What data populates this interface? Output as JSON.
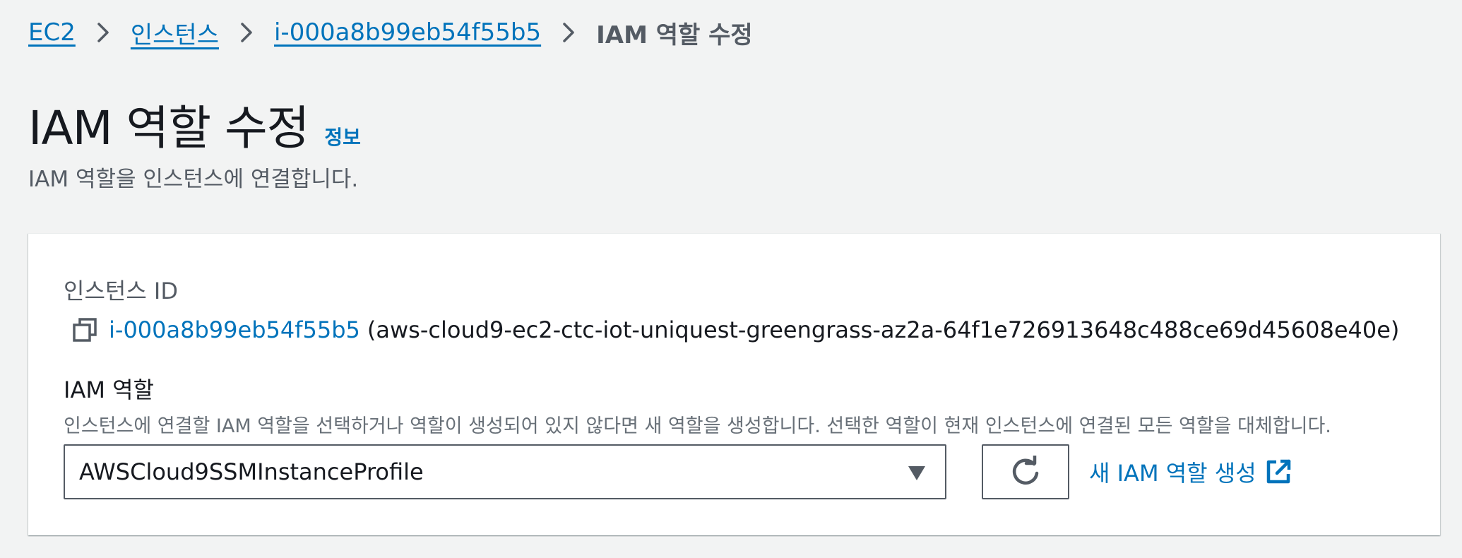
{
  "breadcrumb": {
    "items": [
      {
        "label": "EC2"
      },
      {
        "label": "인스턴스"
      },
      {
        "label": "i-000a8b99eb54f55b5"
      }
    ],
    "current": "IAM 역할 수정"
  },
  "header": {
    "title": "IAM 역할 수정",
    "info_label": "정보",
    "description": "IAM 역할을 인스턴스에 연결합니다."
  },
  "form": {
    "instance_id_label": "인스턴스 ID",
    "instance_id": "i-000a8b99eb54f55b5",
    "instance_name": "(aws-cloud9-ec2-ctc-iot-uniquest-greengrass-az2a-64f1e726913648c488ce69d45608e40e)",
    "iam_role_label": "IAM 역할",
    "iam_role_description": "인스턴스에 연결할 IAM 역할을 선택하거나 역할이 생성되어 있지 않다면 새 역할을 생성합니다. 선택한 역할이 현재 인스턴스에 연결된 모든 역할을 대체합니다.",
    "selected_role": "AWSCloud9SSMInstanceProfile",
    "create_role_label": "새 IAM 역할 생성"
  },
  "icons": {
    "separator": "chevron-right-icon",
    "copy": "copy-icon",
    "caret": "caret-down-icon",
    "refresh": "refresh-icon",
    "external": "external-link-icon"
  },
  "colors": {
    "link": "#0073bb",
    "background": "#f2f3f3",
    "text": "#16191f",
    "muted": "#545b64"
  }
}
